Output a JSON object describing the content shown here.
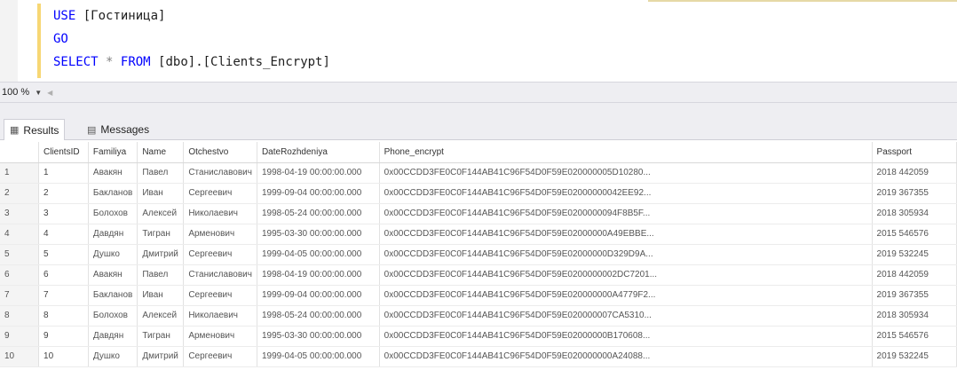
{
  "editor": {
    "line1": {
      "kw": "USE",
      "db": "[Гостиница]"
    },
    "line2": {
      "kw": "GO"
    },
    "line3": {
      "kw_select": "SELECT",
      "star": "*",
      "kw_from": "FROM",
      "obj": "[dbo].[Clients_Encrypt]"
    }
  },
  "zoom": {
    "value": "100 %"
  },
  "tabs": {
    "results": "Results",
    "messages": "Messages"
  },
  "grid": {
    "columns": [
      "",
      "ClientsID",
      "Familiya",
      "Name",
      "Otchestvo",
      "DateRozhdeniya",
      "Phone_encrypt",
      "Passport"
    ],
    "rows": [
      [
        "1",
        "1",
        "Авакян",
        "Павел",
        "Станиславович",
        "1998-04-19 00:00:00.000",
        "0x00CCDD3FE0C0F144AB41C96F54D0F59E020000005D10280...",
        "2018 442059"
      ],
      [
        "2",
        "2",
        "Бакланов",
        "Иван",
        "Сергеевич",
        "1999-09-04 00:00:00.000",
        "0x00CCDD3FE0C0F144AB41C96F54D0F59E02000000042EE92...",
        "2019 367355"
      ],
      [
        "3",
        "3",
        "Болохов",
        "Алексей",
        "Николаевич",
        "1998-05-24 00:00:00.000",
        "0x00CCDD3FE0C0F144AB41C96F54D0F59E0200000094F8B5F...",
        "2018 305934"
      ],
      [
        "4",
        "4",
        "Давдян",
        "Тигран",
        "Арменович",
        "1995-03-30 00:00:00.000",
        "0x00CCDD3FE0C0F144AB41C96F54D0F59E02000000A49EBBE...",
        "2015 546576"
      ],
      [
        "5",
        "5",
        "Душко",
        "Дмитрий",
        "Сергеевич",
        "1999-04-05 00:00:00.000",
        "0x00CCDD3FE0C0F144AB41C96F54D0F59E02000000D329D9A...",
        "2019 532245"
      ],
      [
        "6",
        "6",
        "Авакян",
        "Павел",
        "Станиславович",
        "1998-04-19 00:00:00.000",
        "0x00CCDD3FE0C0F144AB41C96F54D0F59E0200000002DC7201...",
        "2018 442059"
      ],
      [
        "7",
        "7",
        "Бакланов",
        "Иван",
        "Сергеевич",
        "1999-09-04 00:00:00.000",
        "0x00CCDD3FE0C0F144AB41C96F54D0F59E020000000A4779F2...",
        "2019 367355"
      ],
      [
        "8",
        "8",
        "Болохов",
        "Алексей",
        "Николаевич",
        "1998-05-24 00:00:00.000",
        "0x00CCDD3FE0C0F144AB41C96F54D0F59E020000007CA5310...",
        "2018 305934"
      ],
      [
        "9",
        "9",
        "Давдян",
        "Тигран",
        "Арменович",
        "1995-03-30 00:00:00.000",
        "0x00CCDD3FE0C0F144AB41C96F54D0F59E02000000B170608...",
        "2015 546576"
      ],
      [
        "10",
        "10",
        "Душко",
        "Дмитрий",
        "Сергеевич",
        "1999-04-05 00:00:00.000",
        "0x00CCDD3FE0C0F144AB41C96F54D0F59E020000000A24088...",
        "2019 532245"
      ]
    ]
  }
}
